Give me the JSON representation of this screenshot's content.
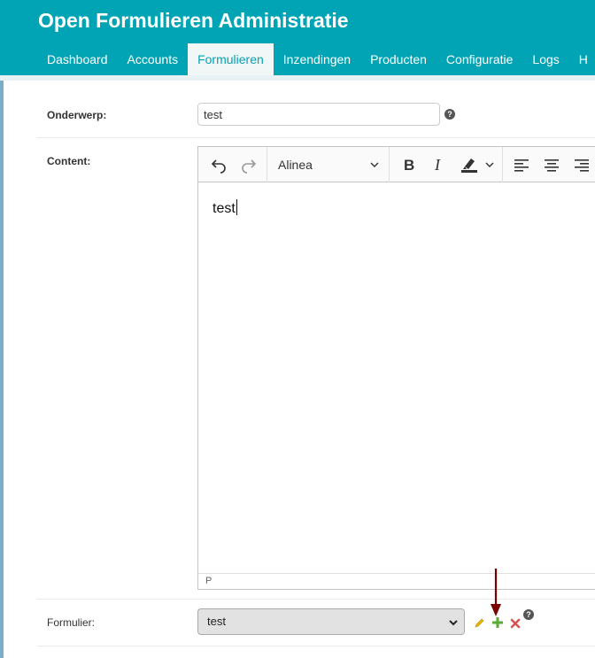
{
  "header": {
    "title": "Open Formulieren Administratie",
    "nav": [
      {
        "label": "Dashboard",
        "active": false
      },
      {
        "label": "Accounts",
        "active": false
      },
      {
        "label": "Formulieren",
        "active": true
      },
      {
        "label": "Inzendingen",
        "active": false
      },
      {
        "label": "Producten",
        "active": false
      },
      {
        "label": "Configuratie",
        "active": false
      },
      {
        "label": "Logs",
        "active": false
      },
      {
        "label": "H",
        "active": false
      }
    ],
    "accent_color": "#00a4b4"
  },
  "form": {
    "subject": {
      "label": "Onderwerp:",
      "value": "test",
      "help_icon": "question-circle-icon"
    },
    "content": {
      "label": "Content:",
      "toolbar": {
        "undo_icon": "undo-icon",
        "redo_icon": "redo-icon",
        "paragraph_style": "Alinea",
        "bold_icon": "bold-icon",
        "italic_icon": "italic-icon",
        "highlight_icon": "highlight-icon",
        "align_left_icon": "align-left-icon",
        "align_center_icon": "align-center-icon",
        "align_right_icon": "align-right-icon"
      },
      "body_text": "test",
      "status_path": "P"
    },
    "formulier": {
      "label": "Formulier:",
      "selected": "test",
      "edit_icon": "pencil-icon",
      "add_icon": "plus-icon",
      "delete_icon": "x-icon",
      "help_icon": "question-circle-icon"
    }
  },
  "annotation": {
    "arrow_color": "#7a0000",
    "arrow_icon": "arrow-down-icon"
  }
}
